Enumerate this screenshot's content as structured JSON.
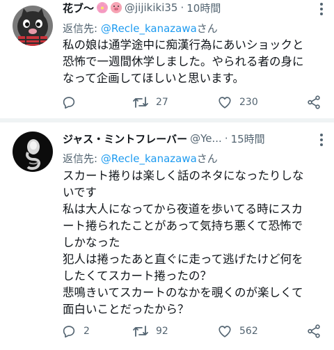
{
  "tweets": [
    {
      "name": "花ブ〜",
      "handle": "@jijikiki35",
      "separator": "·",
      "time": "10時間",
      "reply_prefix": "返信先: ",
      "reply_mention": "@Recle_kanazawa",
      "reply_suffix": "さん",
      "lines": [
        "私の娘は通学途中に痴漢行為にあいショックと",
        "恐怖で一週間休学しました。やられる者の身に",
        "なって企画してほしいと思います。"
      ],
      "reply_count": "",
      "retweet_count": "27",
      "like_count": "230"
    },
    {
      "name": "ジャス・ミントフレーバー",
      "handle": "@Ye...",
      "separator": "·",
      "time": "15時間",
      "reply_prefix": "返信先: ",
      "reply_mention": "@Recle_kanazawa",
      "reply_suffix": "さん",
      "lines": [
        "スカート捲りは楽しく話のネタになったりしな",
        "いです",
        "私は大人になってから夜道を歩いてる時にスカ",
        "ート捲られたことがあって気持ち悪くて恐怖で",
        "しかなった",
        "犯人は捲ったあと直ぐに走って逃げたけど何を",
        "したくてスカート捲ったの？",
        "悲鳴きいてスカートのなかを覗くのが楽しくて",
        "面白いことだったから？"
      ],
      "reply_count": "2",
      "retweet_count": "92",
      "like_count": "562"
    }
  ],
  "colors": {
    "text": "#0f1419",
    "secondary": "#536471",
    "link": "#1d9bf0",
    "divider": "#eff3f4"
  },
  "icons": [
    "reply-icon",
    "retweet-icon",
    "like-icon",
    "share-icon",
    "more-icon",
    "cherry-blossom-emoji",
    "pig-emoji"
  ]
}
